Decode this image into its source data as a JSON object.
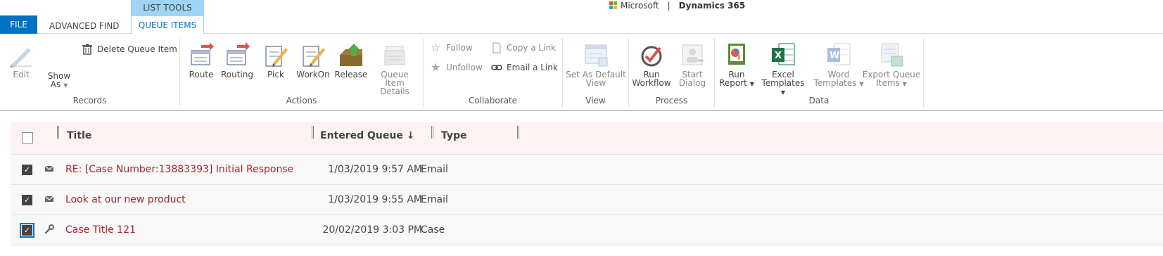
{
  "tabs": {
    "file": "FILE",
    "advanced_find": "ADVANCED FIND",
    "context_group": "LIST TOOLS",
    "queue_items": "QUEUE ITEMS"
  },
  "brand": {
    "microsoft": "Microsoft",
    "separator": "|",
    "product": "Dynamics 365"
  },
  "ribbon": {
    "records": {
      "label": "Records",
      "edit": "Edit",
      "show_as": "Show",
      "show_as_2": "As",
      "delete": "Delete Queue Item"
    },
    "actions": {
      "label": "Actions",
      "route": "Route",
      "routing": "Routing",
      "pick": "Pick",
      "workon": "WorkOn",
      "release": "Release",
      "details_1": "Queue Item",
      "details_2": "Details"
    },
    "collaborate": {
      "label": "Collaborate",
      "follow": "Follow",
      "unfollow": "Unfollow",
      "copy_link": "Copy a Link",
      "email_link": "Email a Link"
    },
    "view": {
      "label": "View",
      "set_default_1": "Set As Default",
      "set_default_2": "View"
    },
    "process": {
      "label": "Process",
      "run_workflow_1": "Run",
      "run_workflow_2": "Workflow",
      "start_dialog_1": "Start",
      "start_dialog_2": "Dialog"
    },
    "data": {
      "label": "Data",
      "run_report_1": "Run",
      "run_report_2": "Report",
      "excel_1": "Excel",
      "excel_2": "Templates",
      "word_1": "Word",
      "word_2": "Templates",
      "export_1": "Export Queue",
      "export_2": "Items"
    }
  },
  "grid": {
    "columns": {
      "title": "Title",
      "entered": "Entered Queue",
      "sort_arrow": "↓",
      "type": "Type"
    },
    "rows": [
      {
        "title": "RE: [Case Number:13883393] Initial Response",
        "entered": "1/03/2019 9:57 AM",
        "type": "Email",
        "icon": "mail-icon"
      },
      {
        "title": "Look at our new product",
        "entered": "1/03/2019 9:55 AM",
        "type": "Email",
        "icon": "mail-icon"
      },
      {
        "title": "Case Title 121",
        "entered": "20/02/2019 3:03 PM",
        "type": "Case",
        "icon": "wrench-icon"
      }
    ]
  },
  "colors": {
    "accent": "#0072c6",
    "context": "#9fd4f3",
    "link_red": "#a4262c"
  }
}
